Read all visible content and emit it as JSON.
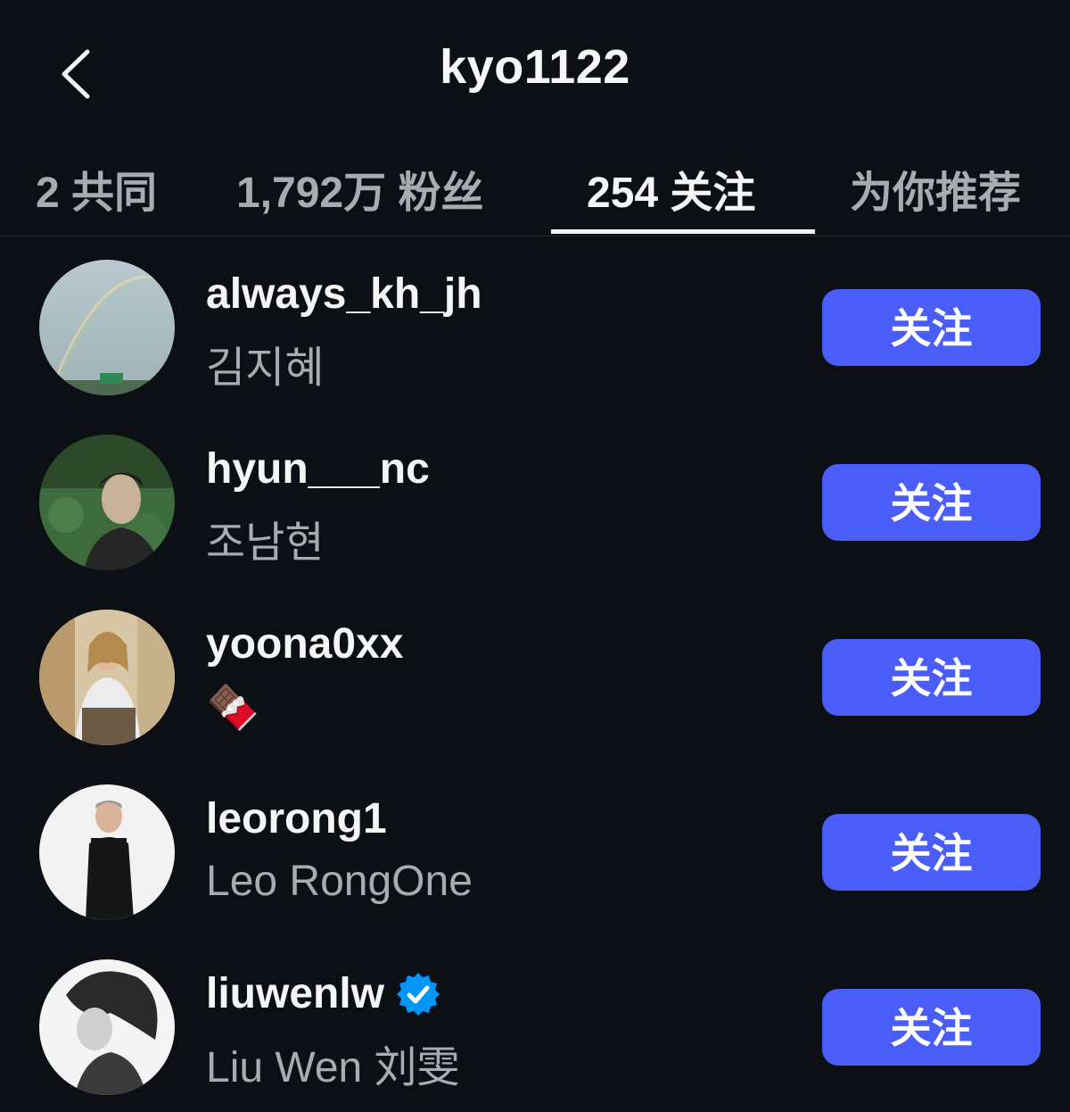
{
  "header": {
    "title": "kyo1122",
    "back_icon": "chevron-left-icon"
  },
  "tabs": [
    {
      "label": "2 共同",
      "active": false
    },
    {
      "label": "1,792万 粉丝",
      "active": false
    },
    {
      "label": "254 关注",
      "active": true
    },
    {
      "label": "为你推荐",
      "active": false
    }
  ],
  "accounts": [
    {
      "username": "always_kh_jh",
      "fullname": "김지혜",
      "verified": false,
      "button": "关注",
      "avatar": "rainbow-photo"
    },
    {
      "username": "hyun___nc",
      "fullname": "조남현",
      "verified": false,
      "button": "关注",
      "avatar": "man-outdoors-photo"
    },
    {
      "username": "yoona0xx",
      "fullname": "🍫",
      "verified": false,
      "button": "关注",
      "avatar": "woman-sitting-photo"
    },
    {
      "username": "leorong1",
      "fullname": "Leo RongOne",
      "verified": false,
      "button": "关注",
      "avatar": "man-in-black-photo"
    },
    {
      "username": "liuwenlw",
      "fullname": "Liu Wen 刘雯",
      "verified": true,
      "button": "关注",
      "avatar": "woman-bw-portrait-photo"
    }
  ],
  "colors": {
    "background": "#0c1014",
    "button": "#4a5df9",
    "secondary_text": "#a8acb0",
    "verified_badge": "#0095f6"
  }
}
